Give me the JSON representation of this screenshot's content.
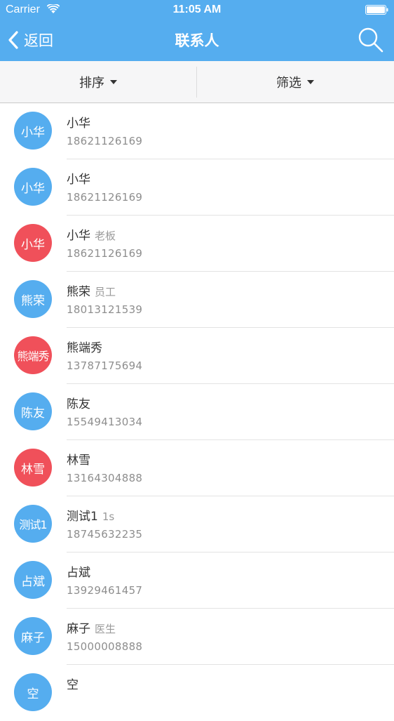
{
  "status_bar": {
    "carrier": "Carrier",
    "time": "11:05 AM"
  },
  "nav": {
    "back_label": "返回",
    "title": "联系人"
  },
  "filters": {
    "sort_label": "排序",
    "filter_label": "筛选"
  },
  "colors": {
    "header": "#55ADEF",
    "avatar_blue": "#55ADEF",
    "avatar_red": "#F0505A"
  },
  "contacts": [
    {
      "avatar_text": "小华",
      "avatar_color": "blue",
      "name": "小华",
      "tag": "",
      "phone": "18621126169"
    },
    {
      "avatar_text": "小华",
      "avatar_color": "blue",
      "name": "小华",
      "tag": "",
      "phone": "18621126169"
    },
    {
      "avatar_text": "小华",
      "avatar_color": "red",
      "name": "小华",
      "tag": "老板",
      "phone": "18621126169"
    },
    {
      "avatar_text": "熊荣",
      "avatar_color": "blue",
      "name": "熊荣",
      "tag": "员工",
      "phone": "18013121539"
    },
    {
      "avatar_text": "熊端秀",
      "avatar_color": "red",
      "name": "熊端秀",
      "tag": "",
      "phone": "13787175694"
    },
    {
      "avatar_text": "陈友",
      "avatar_color": "blue",
      "name": "陈友",
      "tag": "",
      "phone": "15549413034"
    },
    {
      "avatar_text": "林雪",
      "avatar_color": "red",
      "name": "林雪",
      "tag": "",
      "phone": "13164304888"
    },
    {
      "avatar_text": "测试1",
      "avatar_color": "blue",
      "name": "测试1",
      "tag": "1s",
      "phone": "18745632235"
    },
    {
      "avatar_text": "占斌",
      "avatar_color": "blue",
      "name": "占斌",
      "tag": "",
      "phone": "13929461457"
    },
    {
      "avatar_text": "麻子",
      "avatar_color": "blue",
      "name": "麻子",
      "tag": "医生",
      "phone": "15000008888"
    },
    {
      "avatar_text": "空",
      "avatar_color": "blue",
      "name": "空",
      "tag": "",
      "phone": ""
    }
  ],
  "icons": {
    "back": "chevron-left-icon",
    "search": "search-icon",
    "wifi": "wifi-icon",
    "battery": "battery-icon",
    "caret": "caret-down-icon"
  }
}
